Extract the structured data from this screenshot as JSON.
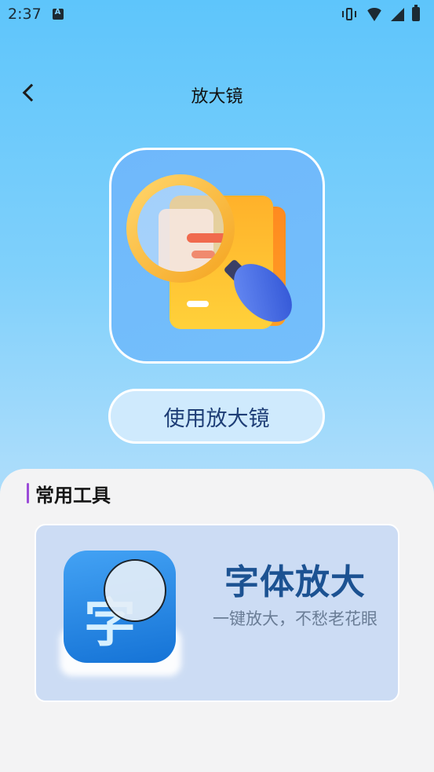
{
  "status_bar": {
    "time": "2:37",
    "icons": [
      "notification-a-icon",
      "vibrate-icon",
      "wifi-icon",
      "signal-icon",
      "battery-charging-icon"
    ]
  },
  "header": {
    "title": "放大镜",
    "back_icon": "chevron-left-icon"
  },
  "hero": {
    "icon": "magnifier-document-icon",
    "button_label": "使用放大镜"
  },
  "tools_section": {
    "title": "常用工具",
    "accent_color": "#9b4bd8",
    "items": [
      {
        "icon": "font-zoom-icon",
        "icon_glyph": "字",
        "name": "字体放大",
        "description": "一键放大，不愁老花眼"
      }
    ]
  },
  "colors": {
    "background_top": "#5ec5fb",
    "background_bottom": "#bfe4fa",
    "button_text": "#1e3e76",
    "tool_name": "#1c5292",
    "tool_card": "#ccdcf4"
  }
}
